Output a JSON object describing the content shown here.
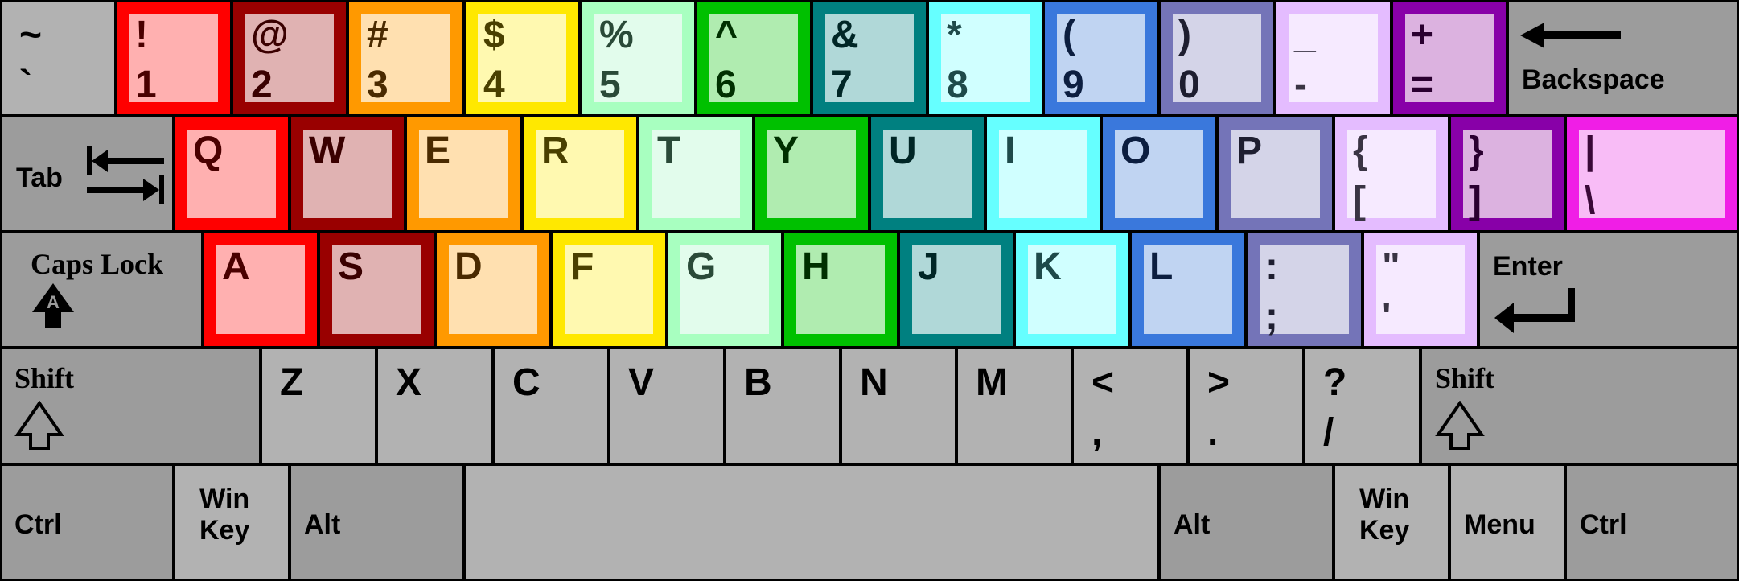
{
  "keyboard": {
    "rows": [
      [
        {
          "id": "backtick",
          "top": "~",
          "bottom": "`",
          "style": "gray"
        },
        {
          "id": "1",
          "top": "!",
          "bottom": "1",
          "color": "red"
        },
        {
          "id": "2",
          "top": "@",
          "bottom": "2",
          "color": "darkred"
        },
        {
          "id": "3",
          "top": "#",
          "bottom": "3",
          "color": "orange"
        },
        {
          "id": "4",
          "top": "$",
          "bottom": "4",
          "color": "yellow"
        },
        {
          "id": "5",
          "top": "%",
          "bottom": "5",
          "color": "mint"
        },
        {
          "id": "6",
          "top": "^",
          "bottom": "6",
          "color": "green"
        },
        {
          "id": "7",
          "top": "&",
          "bottom": "7",
          "color": "teal"
        },
        {
          "id": "8",
          "top": "*",
          "bottom": "8",
          "color": "cyan"
        },
        {
          "id": "9",
          "top": "(",
          "bottom": "9",
          "color": "blue"
        },
        {
          "id": "0",
          "top": ")",
          "bottom": "0",
          "color": "slate"
        },
        {
          "id": "minus",
          "top": "_",
          "bottom": "-",
          "color": "lavender"
        },
        {
          "id": "equals",
          "top": "+",
          "bottom": "=",
          "color": "purple"
        },
        {
          "id": "backspace",
          "label": "Backspace",
          "style": "mod",
          "icon": "left-arrow-icon"
        }
      ],
      [
        {
          "id": "tab",
          "label": "Tab",
          "style": "mod",
          "icon": "tab-arrows-icon"
        },
        {
          "id": "q",
          "single": "Q",
          "color": "red"
        },
        {
          "id": "w",
          "single": "W",
          "color": "darkred"
        },
        {
          "id": "e",
          "single": "E",
          "color": "orange"
        },
        {
          "id": "r",
          "single": "R",
          "color": "yellow"
        },
        {
          "id": "t",
          "single": "T",
          "color": "mint"
        },
        {
          "id": "y",
          "single": "Y",
          "color": "green"
        },
        {
          "id": "u",
          "single": "U",
          "color": "teal"
        },
        {
          "id": "i",
          "single": "I",
          "color": "cyan"
        },
        {
          "id": "o",
          "single": "O",
          "color": "blue"
        },
        {
          "id": "p",
          "single": "P",
          "color": "slate"
        },
        {
          "id": "lbracket",
          "top": "{",
          "bottom": "[",
          "color": "lavender"
        },
        {
          "id": "rbracket",
          "top": "}",
          "bottom": "]",
          "color": "purple"
        },
        {
          "id": "backslash",
          "top": "|",
          "bottom": "\\",
          "color": "magenta"
        }
      ],
      [
        {
          "id": "capslock",
          "label": "Caps Lock",
          "style": "mod",
          "icon": "caps-lock-icon"
        },
        {
          "id": "a",
          "single": "A",
          "color": "red"
        },
        {
          "id": "s",
          "single": "S",
          "color": "darkred"
        },
        {
          "id": "d",
          "single": "D",
          "color": "orange"
        },
        {
          "id": "f",
          "single": "F",
          "color": "yellow"
        },
        {
          "id": "g",
          "single": "G",
          "color": "mint"
        },
        {
          "id": "h",
          "single": "H",
          "color": "green"
        },
        {
          "id": "j",
          "single": "J",
          "color": "teal"
        },
        {
          "id": "k",
          "single": "K",
          "color": "cyan"
        },
        {
          "id": "l",
          "single": "L",
          "color": "blue"
        },
        {
          "id": "semicolon",
          "top": ":",
          "bottom": ";",
          "color": "slate"
        },
        {
          "id": "quote",
          "top": "\"",
          "bottom": "'",
          "color": "lavender"
        },
        {
          "id": "enter",
          "label": "Enter",
          "style": "mod",
          "icon": "enter-arrow-icon"
        }
      ],
      [
        {
          "id": "lshift",
          "label": "Shift",
          "style": "mod",
          "icon": "shift-arrow-icon"
        },
        {
          "id": "z",
          "single": "Z",
          "style": "gray"
        },
        {
          "id": "x",
          "single": "X",
          "style": "gray"
        },
        {
          "id": "c",
          "single": "C",
          "style": "gray"
        },
        {
          "id": "v",
          "single": "V",
          "style": "gray"
        },
        {
          "id": "b",
          "single": "B",
          "style": "gray"
        },
        {
          "id": "n",
          "single": "N",
          "style": "gray"
        },
        {
          "id": "m",
          "single": "M",
          "style": "gray"
        },
        {
          "id": "comma",
          "top": "<",
          "bottom": ",",
          "style": "gray"
        },
        {
          "id": "period",
          "top": ">",
          "bottom": ".",
          "style": "gray"
        },
        {
          "id": "slash",
          "top": "?",
          "bottom": "/",
          "style": "gray"
        },
        {
          "id": "rshift",
          "label": "Shift",
          "style": "mod",
          "icon": "shift-arrow-icon"
        }
      ],
      [
        {
          "id": "lctrl",
          "label": "Ctrl",
          "style": "mod"
        },
        {
          "id": "lwin",
          "label": "Win\nKey",
          "style": "gray"
        },
        {
          "id": "lalt",
          "label": "Alt",
          "style": "mod"
        },
        {
          "id": "space",
          "label": "",
          "style": "gray"
        },
        {
          "id": "ralt",
          "label": "Alt",
          "style": "mod"
        },
        {
          "id": "rwin",
          "label": "Win\nKey",
          "style": "gray"
        },
        {
          "id": "menu",
          "label": "Menu",
          "style": "gray"
        },
        {
          "id": "rctrl",
          "label": "Ctrl",
          "style": "mod"
        }
      ]
    ],
    "colors": {
      "red": {
        "border": "#ff0000",
        "fill": "#ffb0b0",
        "text": "#4a0000"
      },
      "darkred": {
        "border": "#990000",
        "fill": "#e0b2b2",
        "text": "#3a0000"
      },
      "orange": {
        "border": "#ff9900",
        "fill": "#ffe0b0",
        "text": "#4a2a00"
      },
      "yellow": {
        "border": "#ffe800",
        "fill": "#fff9b0",
        "text": "#4a4000"
      },
      "mint": {
        "border": "#a8ffc0",
        "fill": "#e2fcec",
        "text": "#2a4a38"
      },
      "green": {
        "border": "#00c000",
        "fill": "#b0ecb0",
        "text": "#003000"
      },
      "teal": {
        "border": "#008080",
        "fill": "#b0d8d8",
        "text": "#002626"
      },
      "cyan": {
        "border": "#66ffff",
        "fill": "#d0ffff",
        "text": "#1e4a4a"
      },
      "blue": {
        "border": "#3a78dc",
        "fill": "#c0d4f2",
        "text": "#0c1e40"
      },
      "slate": {
        "border": "#7474b8",
        "fill": "#d4d4e8",
        "text": "#1e1e30"
      },
      "lavender": {
        "border": "#e4bcff",
        "fill": "#f6eaff",
        "text": "#3a3444"
      },
      "purple": {
        "border": "#8800a8",
        "fill": "#dcb2e0",
        "text": "#2a0030"
      },
      "magenta": {
        "border": "#f01ee6",
        "fill": "#f8bcf6",
        "text": "#3a0838"
      }
    }
  }
}
